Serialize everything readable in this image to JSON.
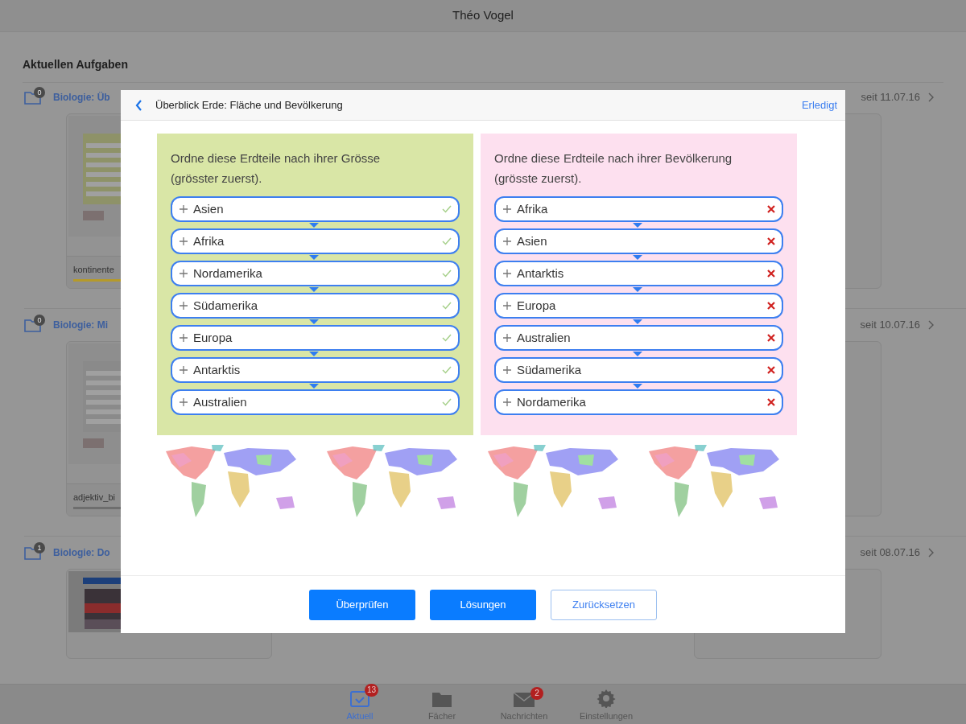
{
  "header": {
    "title": "Théo Vogel"
  },
  "section_title": "Aktuellen Aufgaben",
  "tasks": [
    {
      "badge": "0",
      "title": "Biologie: Üb",
      "date": "seit 11.07.16",
      "file": "kontinente"
    },
    {
      "badge": "0",
      "title": "Biologie: Mi",
      "date": "seit 10.07.16",
      "file": "adjektiv_bi"
    },
    {
      "badge": "1",
      "title": "Biologie: Do",
      "date": "seit 08.07.16"
    }
  ],
  "dialog": {
    "title": "Überblick Erde: Fläche und Bevölkerung",
    "done": "Erledigt",
    "exercises": [
      {
        "color": "#d9e6a6",
        "prompt": "Ordne diese Erdteile nach ihrer Grösse (grösster zuerst).",
        "items": [
          {
            "label": "Asien",
            "correct": true
          },
          {
            "label": "Afrika",
            "correct": true
          },
          {
            "label": "Nordamerika",
            "correct": true
          },
          {
            "label": "Südamerika",
            "correct": true
          },
          {
            "label": "Europa",
            "correct": true
          },
          {
            "label": "Antarktis",
            "correct": true
          },
          {
            "label": "Australien",
            "correct": true
          }
        ]
      },
      {
        "color": "#fde0ef",
        "prompt": "Ordne diese Erdteile nach ihrer Bevölkerung (grösste zuerst).",
        "items": [
          {
            "label": "Afrika",
            "correct": false
          },
          {
            "label": "Asien",
            "correct": false
          },
          {
            "label": "Antarktis",
            "correct": false
          },
          {
            "label": "Europa",
            "correct": false
          },
          {
            "label": "Australien",
            "correct": false
          },
          {
            "label": "Südamerika",
            "correct": false
          },
          {
            "label": "Nordamerika",
            "correct": false
          }
        ]
      }
    ],
    "buttons": [
      {
        "label": "Überprüfen",
        "kind": "primary"
      },
      {
        "label": "Lösungen",
        "kind": "primary"
      },
      {
        "label": "Zurücksetzen",
        "kind": "outline"
      }
    ]
  },
  "tabs": [
    {
      "label": "Aktuell",
      "selected": true,
      "badge": "13"
    },
    {
      "label": "Fächer",
      "selected": false
    },
    {
      "label": "Nachrichten",
      "selected": false,
      "badge": "2"
    },
    {
      "label": "Einstellungen",
      "selected": false
    }
  ]
}
